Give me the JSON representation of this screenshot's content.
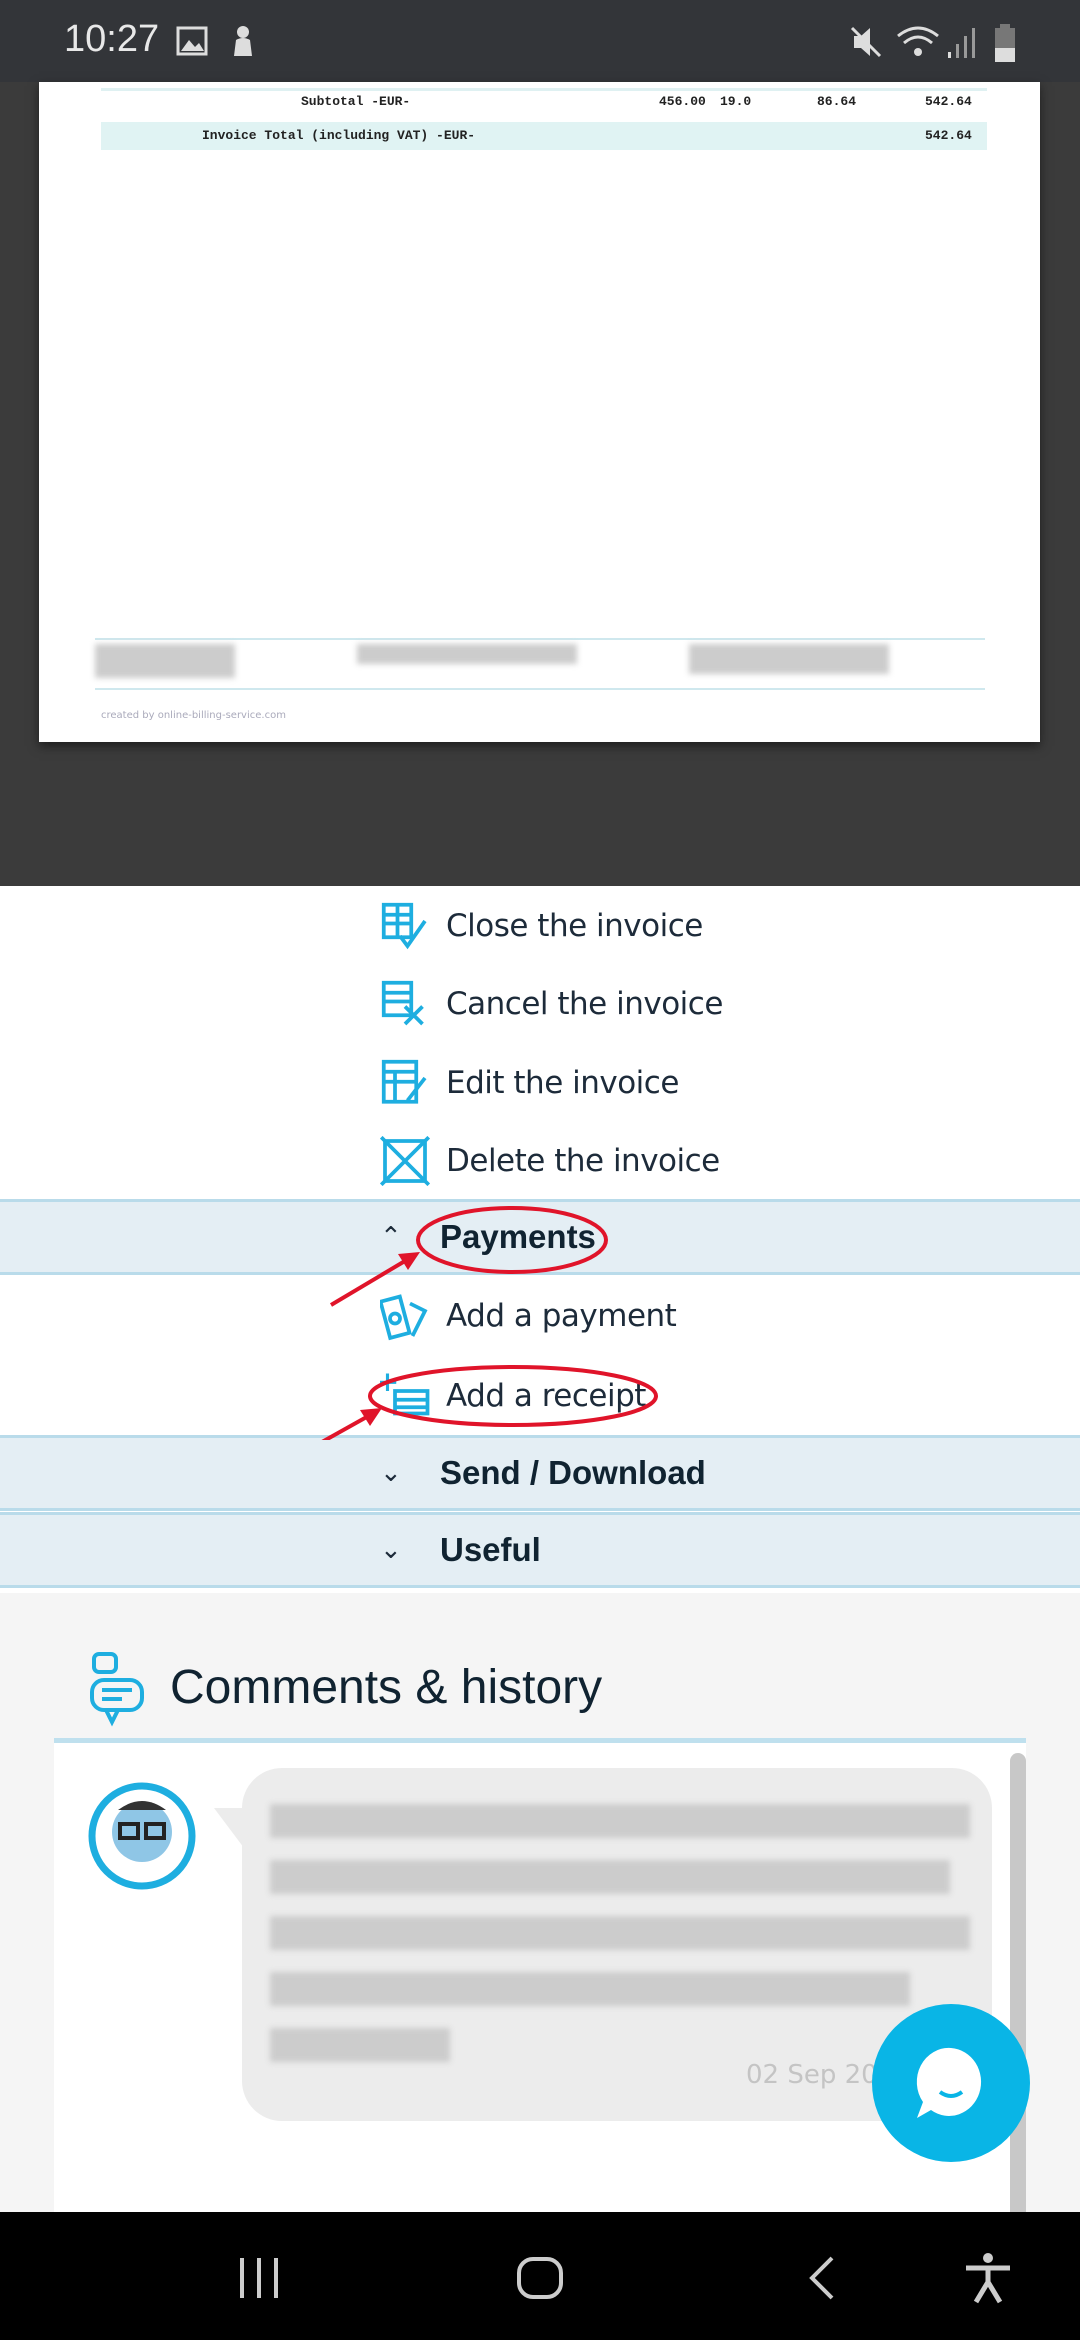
{
  "status_bar": {
    "time": "10:27",
    "icons": [
      "image-icon",
      "android-icon",
      "mute-icon",
      "wifi-icon",
      "signal-icon",
      "battery-icon"
    ]
  },
  "invoice": {
    "subtotal": {
      "label": "Subtotal -EUR-",
      "net": "456.00",
      "vat_rate": "19.0",
      "vat": "86.64",
      "gross": "542.64"
    },
    "total": {
      "label": "Invoice Total (including VAT) -EUR-",
      "value": "542.64"
    },
    "footer_credit": "created by online-billing-service.com"
  },
  "actions": [
    {
      "label": "Close the invoice",
      "icon": "close-invoice-icon"
    },
    {
      "label": "Cancel the invoice",
      "icon": "cancel-invoice-icon"
    },
    {
      "label": "Edit the invoice",
      "icon": "edit-invoice-icon"
    },
    {
      "label": "Delete the invoice",
      "icon": "delete-invoice-icon"
    }
  ],
  "sections": {
    "payments": {
      "label": "Payments",
      "expanded": true,
      "items": [
        {
          "label": "Add a payment",
          "icon": "payment-icon"
        },
        {
          "label": "Add a receipt",
          "icon": "receipt-icon"
        }
      ]
    },
    "send": {
      "label": "Send / Download",
      "expanded": false
    },
    "useful": {
      "label": "Useful",
      "expanded": false
    }
  },
  "comments": {
    "title": "Comments & history",
    "date": "02 Sep 202"
  },
  "colors": {
    "accent": "#1eaee0",
    "annotation": "#e0142a",
    "band": "#e4eef4"
  }
}
